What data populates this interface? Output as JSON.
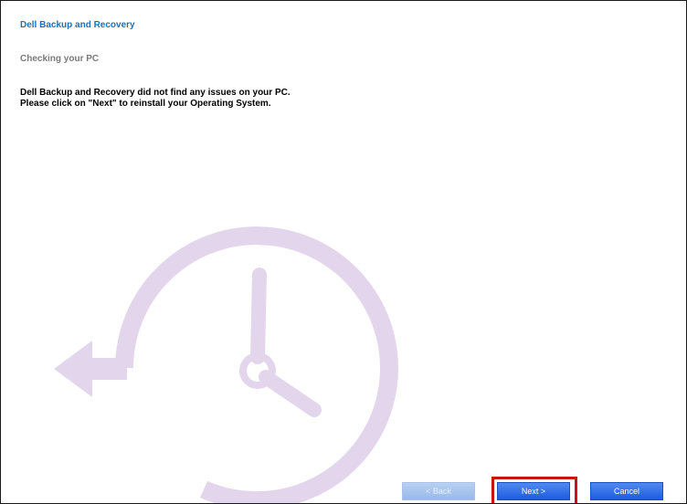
{
  "app": {
    "title": "Dell Backup and Recovery"
  },
  "step": {
    "title": "Checking your PC"
  },
  "message": {
    "line1": "Dell Backup and Recovery did not find any issues on your PC.",
    "line2": "Please click on \"Next\" to reinstall your Operating System."
  },
  "buttons": {
    "back_label": "< Back",
    "next_label": "Next >",
    "cancel_label": "Cancel"
  },
  "colors": {
    "title_blue": "#1e6fb8",
    "watermark_lilac": "#e3d6ec",
    "button_blue": "#2a66e4",
    "highlight_red": "#cc1111"
  },
  "icons": {
    "watermark": "restore-clock-icon"
  }
}
